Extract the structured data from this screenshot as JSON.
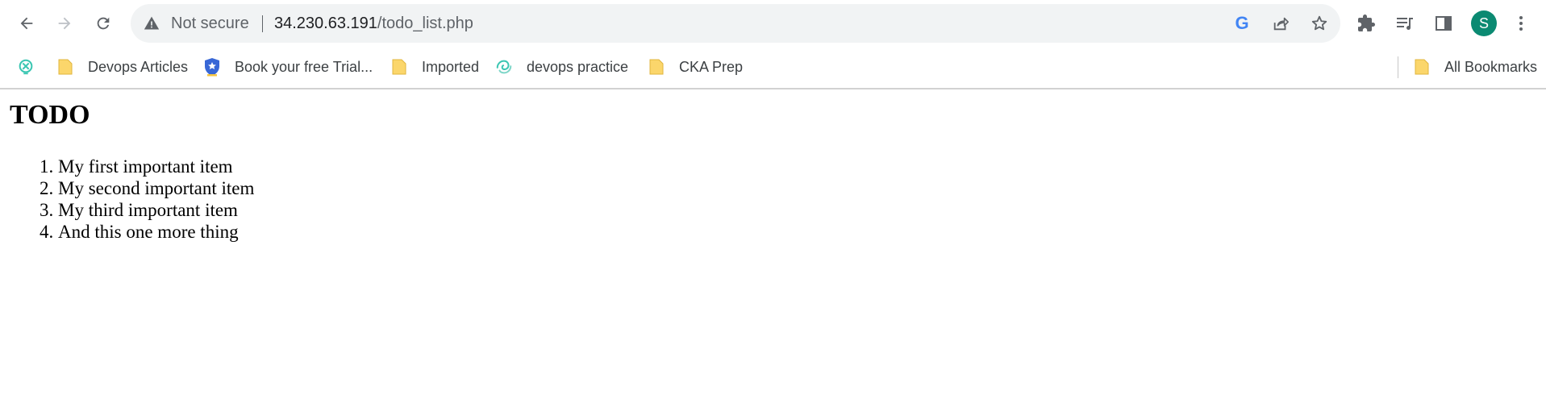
{
  "browser": {
    "security_label": "Not secure",
    "url_host": "34.230.63.191",
    "url_path": "/todo_list.php",
    "profile_initial": "S",
    "google_letter": "G"
  },
  "bookmarks": {
    "items": [
      {
        "label": "",
        "icon": "globe-cross-icon"
      },
      {
        "label": "Devops Articles",
        "icon": "folder-icon"
      },
      {
        "label": "Book your free Trial...",
        "icon": "shield-star-icon"
      },
      {
        "label": "Imported",
        "icon": "folder-icon"
      },
      {
        "label": "devops practice",
        "icon": "swirl-icon"
      },
      {
        "label": "CKA Prep",
        "icon": "folder-icon"
      }
    ],
    "all_bookmarks_label": "All Bookmarks"
  },
  "page": {
    "heading": "TODO",
    "items": [
      "My first important item",
      "My second important item",
      "My third important item",
      "And this one more thing"
    ]
  },
  "colors": {
    "avatar": "#0b8a72",
    "folder": "#fbd66b",
    "omnibox_bg": "#f1f3f4"
  }
}
